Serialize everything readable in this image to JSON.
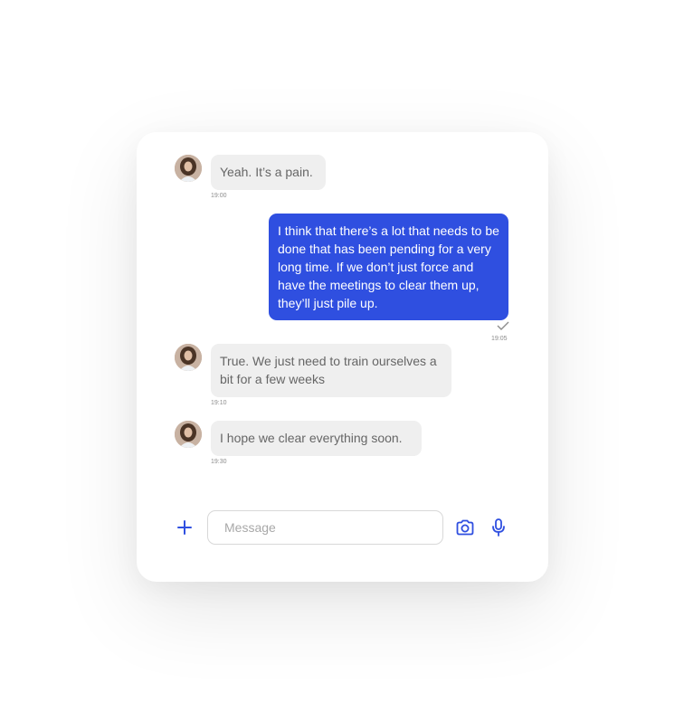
{
  "messages": [
    {
      "text": "Yeah. It’s a pain.",
      "time": "19:00",
      "direction": "incoming"
    },
    {
      "text": "I think that there’s a lot that needs to be done that has been pending for a very long time. If we don’t just force and have the meetings to clear them up, they’ll just pile up.",
      "time": "19:05",
      "direction": "outgoing",
      "status": "sent-check"
    },
    {
      "text": "True. We just need to train ourselves a bit for a few weeks",
      "time": "19:10",
      "direction": "incoming"
    },
    {
      "text": "I hope we clear everything soon.",
      "time": "19:30",
      "direction": "incoming"
    }
  ],
  "composer": {
    "placeholder": "Message",
    "value": "",
    "icons": [
      "plus-icon",
      "camera-icon",
      "microphone-icon"
    ]
  },
  "colors": {
    "accent": "#2f4fe0",
    "incoming_bubble": "#efefef",
    "incoming_text": "#666666"
  }
}
